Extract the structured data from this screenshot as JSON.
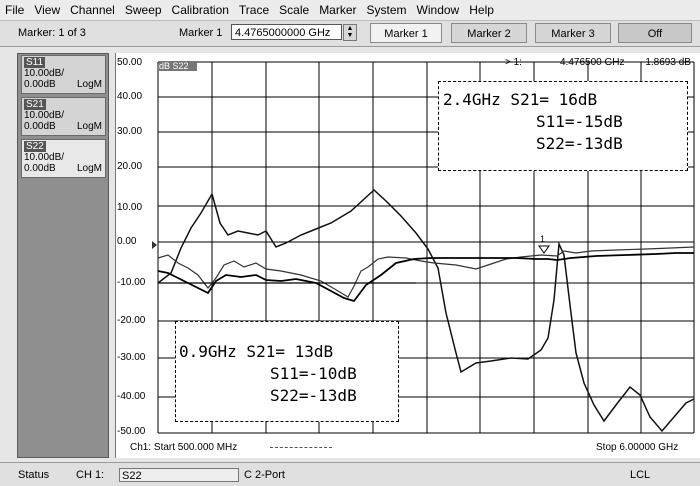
{
  "menu": [
    "File",
    "View",
    "Channel",
    "Sweep",
    "Calibration",
    "Trace",
    "Scale",
    "Marker",
    "System",
    "Window",
    "Help"
  ],
  "toolbar": {
    "marker_count": "Marker: 1 of 3",
    "marker_label": "Marker 1",
    "marker_value": "4.4765000000 GHz",
    "buttons": [
      "Marker 1",
      "Marker 2",
      "Marker 3",
      "Off"
    ]
  },
  "traces": [
    {
      "name": "S11",
      "scale": "10.00dB/",
      "ref": "0.00dB",
      "format": "LogM"
    },
    {
      "name": "S21",
      "scale": "10.00dB/",
      "ref": "0.00dB",
      "format": "LogM"
    },
    {
      "name": "S22",
      "scale": "10.00dB/",
      "ref": "0.00dB",
      "format": "LogM"
    }
  ],
  "plot": {
    "active_trace": "dB S22",
    "marker_readout": "> 1:",
    "marker_freq": "4.476500 GHz",
    "marker_val": "-1.8693 dB",
    "start_label": "Ch1: Start 500.000 MHz",
    "stop_label": "Stop 6.00000 GHz",
    "marker_flag": "1",
    "y_ticks": [
      "50.00",
      "40.00",
      "30.00",
      "20.00",
      "10.00",
      "0.00",
      "-10.00",
      "-20.00",
      "-30.00",
      "-40.00",
      "-50.00"
    ]
  },
  "annotations": {
    "high": [
      "2.4GHz S21= 16dB",
      "S11=-15dB",
      "S22=-13dB"
    ],
    "low": [
      "0.9GHz S21= 13dB",
      "S11=-10dB",
      "S22=-13dB"
    ]
  },
  "status": {
    "label": "Status",
    "channel": "CH 1:",
    "param": "S22",
    "mode": "C  2-Port",
    "lcl": "LCL"
  }
}
